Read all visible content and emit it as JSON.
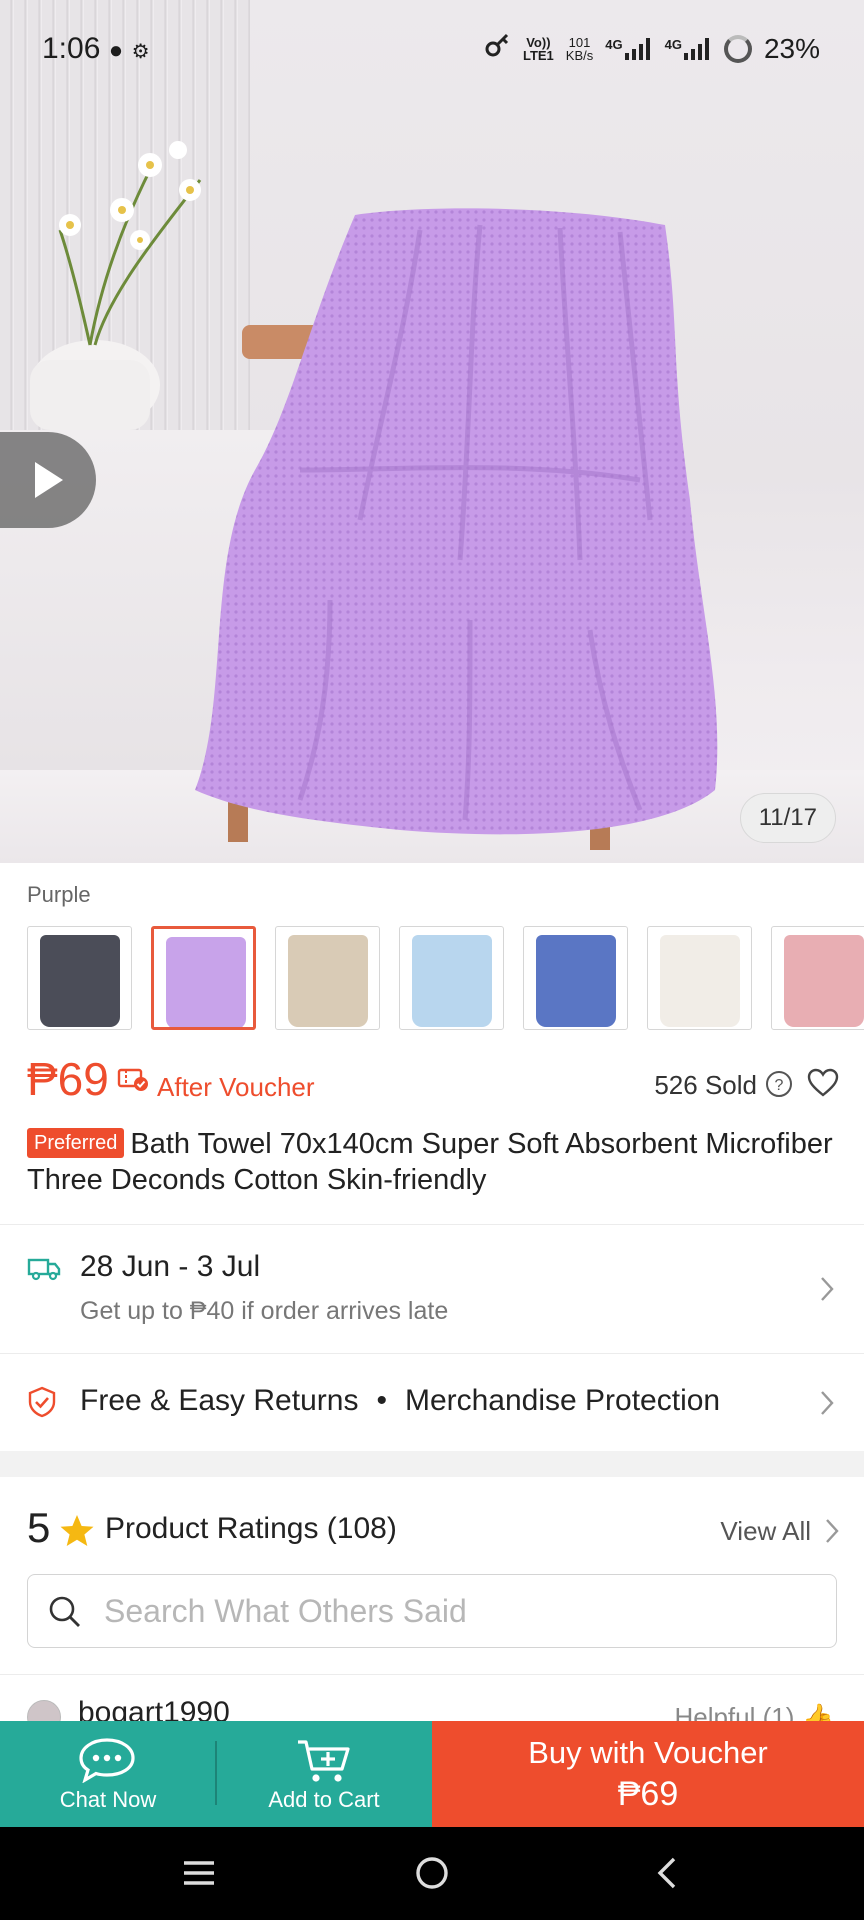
{
  "status": {
    "time": "1:06",
    "net_volte": "Vo))",
    "net_lte": "LTE1",
    "speed_value": "101",
    "speed_unit": "KB/s",
    "sim1": "4G",
    "sim2": "4G",
    "battery": "23%"
  },
  "gallery": {
    "counter": "11/17"
  },
  "variation": {
    "selected_label": "Purple",
    "thumbs": [
      {
        "color": "#4b4d58"
      },
      {
        "color": "#c8a3ea"
      },
      {
        "color": "#d9cbb6"
      },
      {
        "color": "#b8d6ee"
      },
      {
        "color": "#5a76c4"
      },
      {
        "color": "#f1ede7"
      },
      {
        "color": "#e8aeb3"
      }
    ]
  },
  "price": {
    "value": "₱69",
    "after_voucher": "After Voucher",
    "sold": "526 Sold"
  },
  "title": {
    "badge": "Preferred",
    "text": "Bath Towel  70x140cm Super Soft Absorbent Microfiber Three Deconds Cotton Skin-friendly"
  },
  "shipping": {
    "date": "28 Jun - 3 Jul",
    "guarantee": "Get up to ₱40 if order arrives late"
  },
  "returns": {
    "item1": "Free & Easy Returns",
    "separator": "•",
    "item2": "Merchandise Protection"
  },
  "ratings": {
    "score": "5",
    "label": "Product Ratings (108)",
    "view_all": "View All"
  },
  "search": {
    "placeholder": "Search What Others Said"
  },
  "review": {
    "user": "bogart1990",
    "helpful": "Helpful (1)"
  },
  "actions": {
    "chat": "Chat Now",
    "cart": "Add to Cart",
    "buy_line1": "Buy with Voucher",
    "buy_line2": "₱69"
  },
  "colors": {
    "accent": "#ee4d2d",
    "teal": "#26aa99",
    "towel": "#c79be8"
  }
}
